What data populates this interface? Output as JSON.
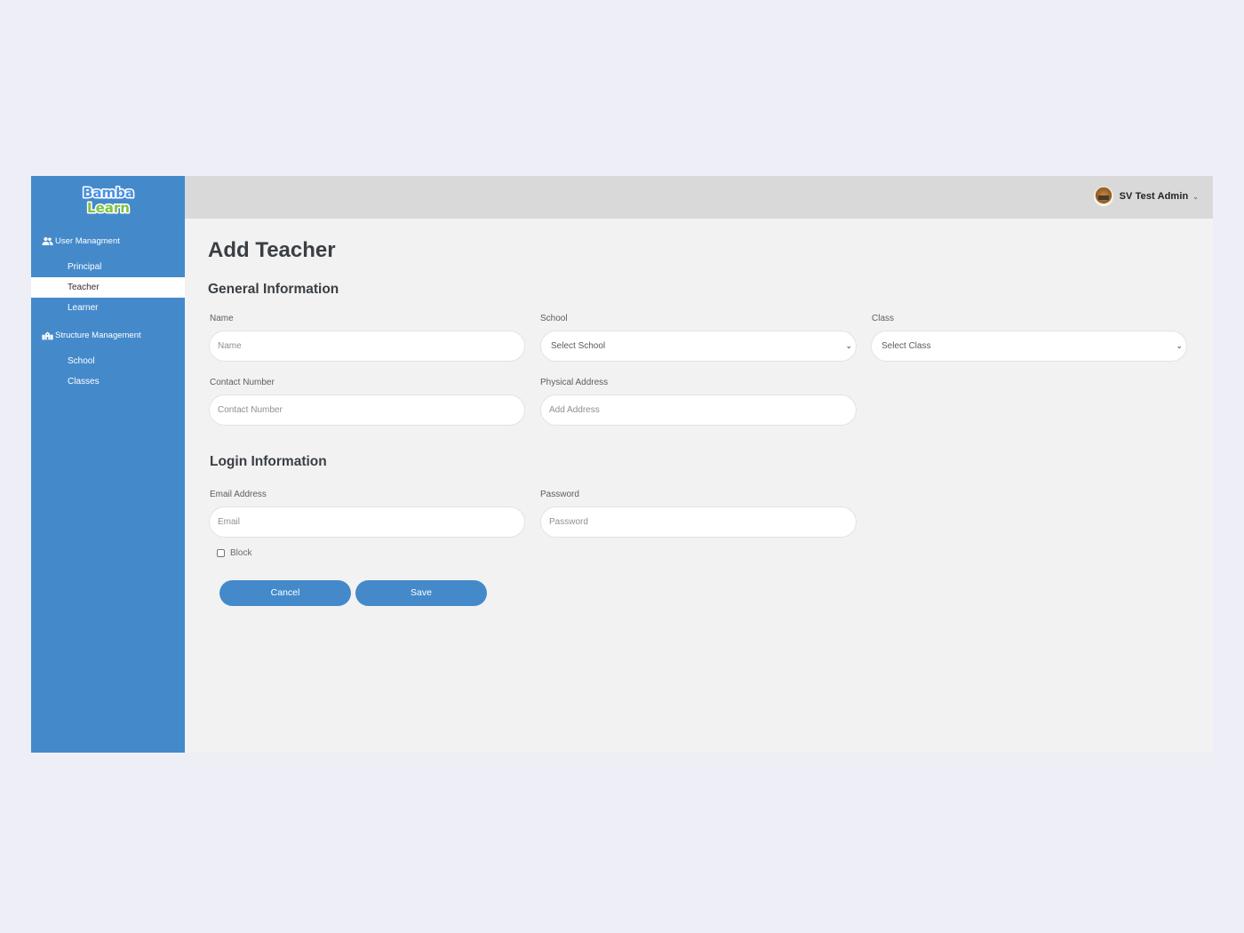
{
  "brand": {
    "logo_line1": "Bamba",
    "logo_line2": "Learn"
  },
  "sidebar": {
    "sections": [
      {
        "label": "User Managment",
        "icon": "users-icon",
        "items": [
          {
            "label": "Principal",
            "active": false
          },
          {
            "label": "Teacher",
            "active": true
          },
          {
            "label": "Learner",
            "active": false
          }
        ]
      },
      {
        "label": "Structure Management",
        "icon": "school-building-icon",
        "items": [
          {
            "label": "School",
            "active": false
          },
          {
            "label": "Classes",
            "active": false
          }
        ]
      }
    ]
  },
  "header": {
    "user_name": "SV Test Admin",
    "avatar_icon": "avatar",
    "menu_icon": "chevron-down-icon"
  },
  "page": {
    "title": "Add Teacher",
    "general_section": "General Information",
    "login_section": "Login Information"
  },
  "form": {
    "name": {
      "label": "Name",
      "placeholder": "Name",
      "value": ""
    },
    "school": {
      "label": "School",
      "selected": "Select School"
    },
    "class": {
      "label": "Class",
      "selected": "Select Class"
    },
    "contact": {
      "label": "Contact Number",
      "placeholder": "Contact Number",
      "value": ""
    },
    "address": {
      "label": "Physical Address",
      "placeholder": "Add Address",
      "value": ""
    },
    "email": {
      "label": "Email Address",
      "placeholder": "Email",
      "value": ""
    },
    "password": {
      "label": "Password",
      "placeholder": "Password",
      "value": ""
    },
    "block": {
      "label": "Block",
      "checked": false
    },
    "cancel_label": "Cancel",
    "save_label": "Save"
  },
  "colors": {
    "primary": "#448acb",
    "topbar": "#d9d9d9",
    "content_bg": "#f2f2f2",
    "page_bg": "#eeeff6"
  }
}
